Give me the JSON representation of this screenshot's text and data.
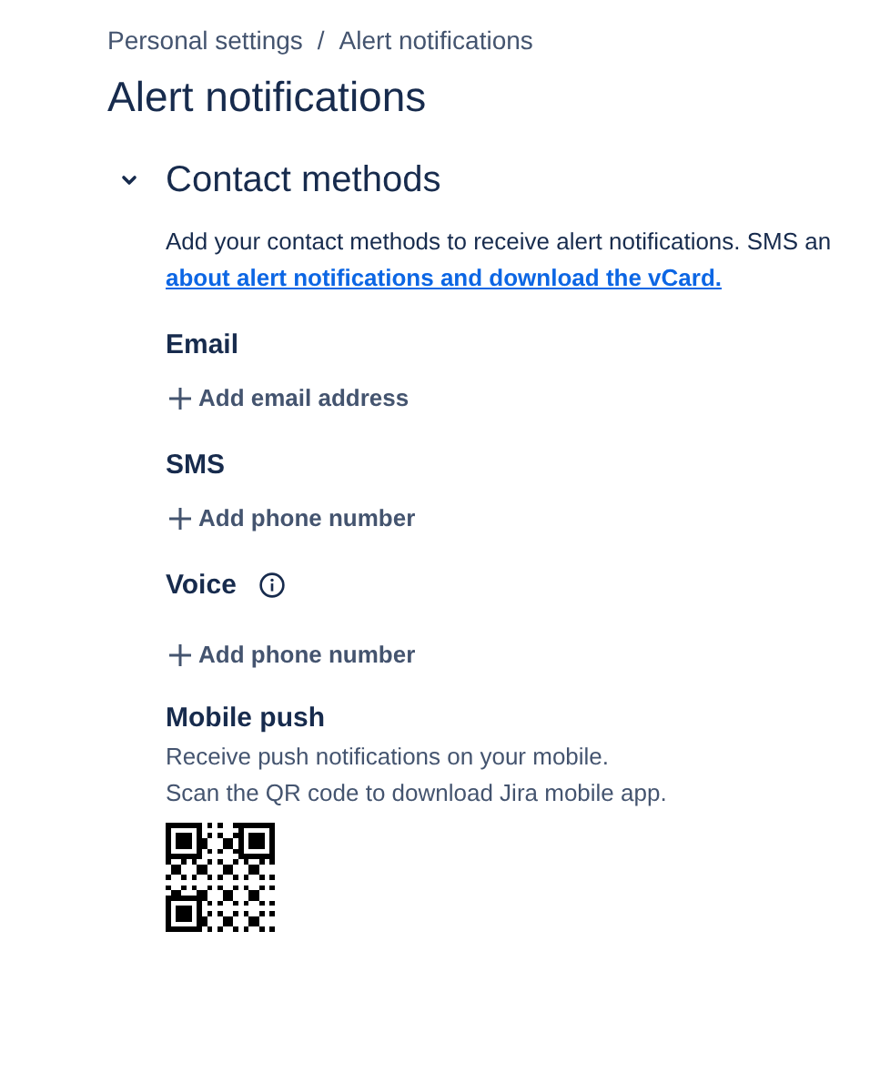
{
  "breadcrumbs": [
    "Personal settings",
    "Alert notifications"
  ],
  "breadcrumb_separator": "/",
  "title": "Alert notifications",
  "section": {
    "title": "Contact methods",
    "expanded": true,
    "intro": "Add your contact methods to receive alert notifications. SMS an",
    "link": "about alert notifications and download the vCard.",
    "methods": [
      {
        "label": "Email",
        "info": false,
        "action": "Add email address"
      },
      {
        "label": "SMS",
        "info": false,
        "action": "Add phone number"
      },
      {
        "label": "Voice",
        "info": true,
        "action": "Add phone number"
      }
    ],
    "mobile": {
      "label": "Mobile push",
      "lines": [
        "Receive push notifications on your mobile.",
        "Scan the QR code to download Jira mobile app."
      ]
    }
  }
}
